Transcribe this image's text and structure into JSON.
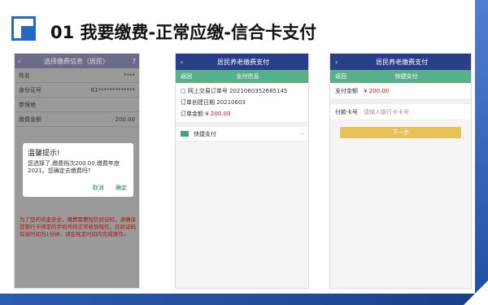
{
  "slide_title": "01 我要缴费-正常应缴-信合卡支付",
  "screen1": {
    "header_title": "选择缴费信息（居民）",
    "rows": [
      {
        "label": "姓名",
        "value": "****"
      },
      {
        "label": "身份证号",
        "value": "61*************"
      },
      {
        "label": "参保地",
        "value": ""
      },
      {
        "label": "缴费金额",
        "value": "200.00"
      }
    ],
    "dialog": {
      "title": "温馨提示!",
      "message": "您选择了,缴费档次200.00,缴费年度2021。您确定去缴费吗?",
      "cancel": "取消",
      "confirm": "确定"
    },
    "warning": "为了您的资金安全，缴费需要短信验证码，请确保您银行卡绑定的手机号码正常收到短信，且验证码有效时间为1分钟，请在规定时间内完成操作。"
  },
  "screen2": {
    "header_title": "居民养老缴费支付",
    "back": "返回",
    "sub_title": "支付信息",
    "order_no_label": "网上交易订单号",
    "order_no": "2021060352685145",
    "created_label": "订单创建日期",
    "created": "20210603",
    "amount_label": "订单金额",
    "amount": "¥ 200.00",
    "pay_option": "快捷支付"
  },
  "screen3": {
    "header_title": "居民养老缴费支付",
    "back": "返回",
    "sub_title": "快捷支付",
    "amount_label": "支付金额",
    "amount": "¥ 200.00",
    "card_label": "付款卡号",
    "card_placeholder": "请输入银行卡卡号",
    "next": "下一步"
  }
}
